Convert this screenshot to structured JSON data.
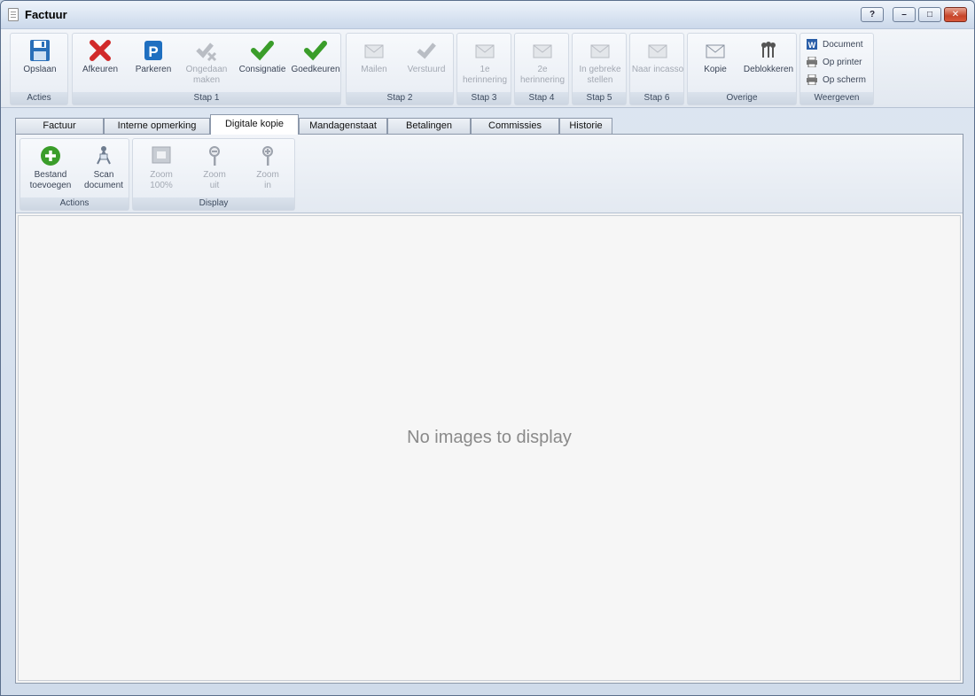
{
  "window": {
    "title": "Factuur",
    "help_label": "?",
    "minimize_label": "–",
    "maximize_label": "□",
    "close_label": "✕"
  },
  "ribbon": {
    "groups": {
      "acties": "Acties",
      "stap1": "Stap 1",
      "stap2": "Stap 2",
      "stap3": "Stap 3",
      "stap4": "Stap 4",
      "stap5": "Stap 5",
      "stap6": "Stap 6",
      "overige": "Overige",
      "weergeven": "Weergeven"
    },
    "buttons": {
      "opslaan": "Opslaan",
      "afkeuren": "Afkeuren",
      "parkeren": "Parkeren",
      "ongedaan_1": "Ongedaan",
      "ongedaan_2": "maken",
      "consignatie": "Consignatie",
      "goedkeuren": "Goedkeuren",
      "mailen": "Mailen",
      "verstuurd": "Verstuurd",
      "herinnering1_1": "1e",
      "herinnering1_2": "herinnering",
      "herinnering2_1": "2e",
      "herinnering2_2": "herinnering",
      "gebreke_1": "In gebreke",
      "gebreke_2": "stellen",
      "incasso": "Naar incasso",
      "kopie": "Kopie",
      "deblokkeren": "Deblokkeren",
      "document": "Document",
      "op_printer": "Op printer",
      "op_scherm": "Op scherm"
    }
  },
  "tabs": [
    {
      "label": "Factuur"
    },
    {
      "label": "Interne opmerking"
    },
    {
      "label": "Digitale kopie"
    },
    {
      "label": "Mandagenstaat"
    },
    {
      "label": "Betalingen"
    },
    {
      "label": "Commissies"
    },
    {
      "label": "Historie"
    }
  ],
  "active_tab": "Digitale kopie",
  "subribbon": {
    "groups": {
      "actions": "Actions",
      "display": "Display"
    },
    "buttons": {
      "bestand_1": "Bestand",
      "bestand_2": "toevoegen",
      "scan_1": "Scan",
      "scan_2": "document",
      "zoom100_1": "Zoom",
      "zoom100_2": "100%",
      "zoomuit_1": "Zoom",
      "zoomuit_2": "uit",
      "zoomin_1": "Zoom",
      "zoomin_2": "in"
    }
  },
  "viewer": {
    "empty_message": "No images to display"
  },
  "colors": {
    "accent_green": "#3a9d2a",
    "accent_red": "#d12a2a",
    "accent_blue": "#1f6fc0"
  }
}
